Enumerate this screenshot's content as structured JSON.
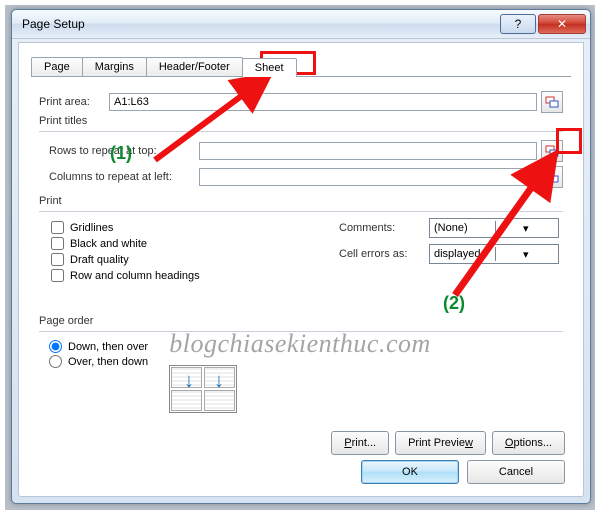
{
  "window": {
    "title": "Page Setup"
  },
  "tabs": {
    "page": "Page",
    "margins": "Margins",
    "headerfooter": "Header/Footer",
    "sheet": "Sheet",
    "active": "sheet"
  },
  "print_area": {
    "label": "Print area:",
    "value": "A1:L63"
  },
  "print_titles": {
    "heading": "Print titles",
    "rows_label": "Rows to repeat at top:",
    "rows_value": "",
    "cols_label": "Columns to repeat at left:",
    "cols_value": ""
  },
  "print_group": {
    "heading": "Print",
    "gridlines": "Gridlines",
    "bw": "Black and white",
    "draft": "Draft quality",
    "rowcol": "Row and column headings",
    "comments_label": "Comments:",
    "comments_value": "(None)",
    "cellerr_label": "Cell errors as:",
    "cellerr_value": "displayed"
  },
  "page_order": {
    "heading": "Page order",
    "down_over": "Down, then over",
    "over_down": "Over, then down",
    "selected": "down_over"
  },
  "buttons": {
    "print": "Print...",
    "preview": "Print Preview",
    "options": "Options...",
    "ok": "OK",
    "cancel": "Cancel"
  },
  "annotations": {
    "one": "(1)",
    "two": "(2)",
    "watermark": "blogchiasekienthuc.com"
  }
}
